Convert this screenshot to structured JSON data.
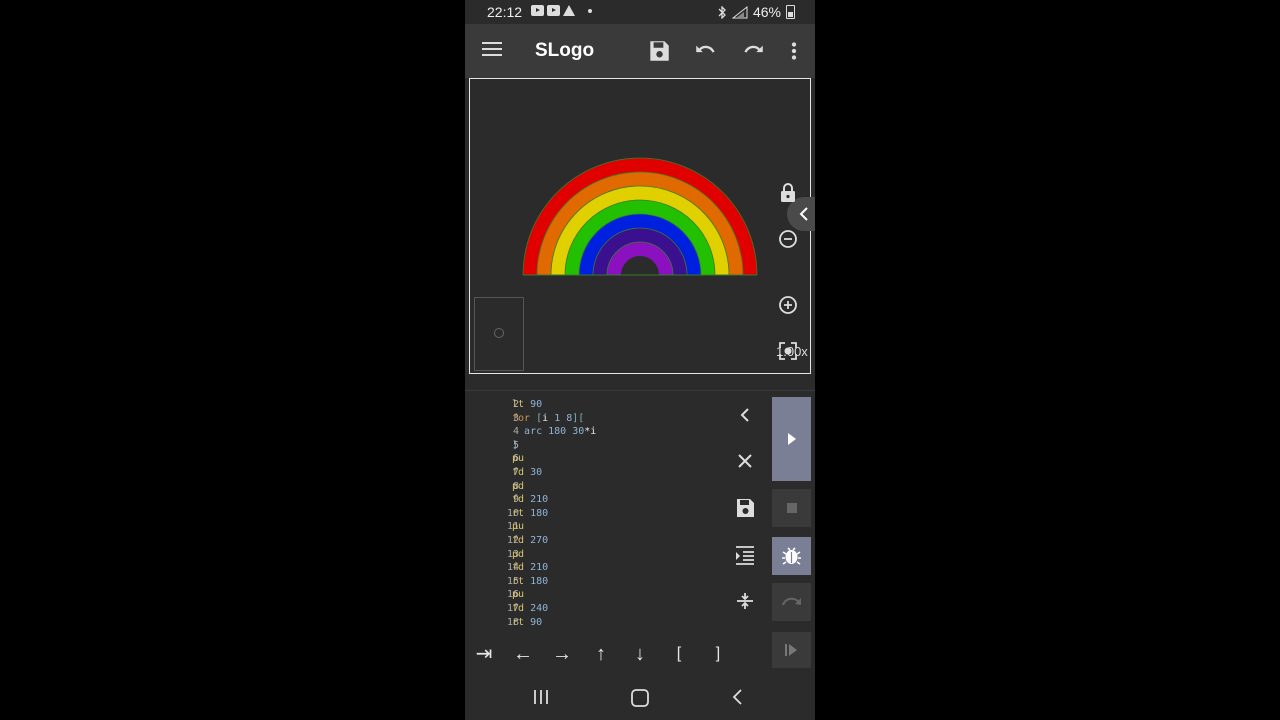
{
  "status_bar": {
    "time": "22:12",
    "battery": "46%",
    "icons": [
      "youtube-icon",
      "youtube-icon",
      "warning-icon",
      "bluetooth-icon",
      "signal-icon",
      "battery-icon"
    ]
  },
  "app_bar": {
    "title": "SLogo",
    "actions": [
      "save-icon",
      "undo-icon",
      "redo-icon",
      "more-vert-icon"
    ]
  },
  "canvas": {
    "zoom_level": "1.00x",
    "controls": [
      "collapse-icon",
      "lock-icon",
      "zoom-out-icon",
      "zoom-in-icon",
      "fit-screen-icon"
    ],
    "rainbow_colors": [
      "#e00000",
      "#e06a00",
      "#e0d000",
      "#22c000",
      "#0020e0",
      "#3a1090",
      "#8a10c0"
    ]
  },
  "editor": {
    "lines": [
      {
        "no": "2",
        "tokens": [
          [
            "kw",
            "lt"
          ],
          [
            "sp",
            " "
          ],
          [
            "num",
            "90"
          ]
        ]
      },
      {
        "no": "3",
        "tokens": [
          [
            "kw2",
            "for"
          ],
          [
            "sp",
            " "
          ],
          [
            "br",
            "["
          ],
          [
            "var",
            "i"
          ],
          [
            "sp",
            " "
          ],
          [
            "num",
            "1"
          ],
          [
            "sp",
            " "
          ],
          [
            "num",
            "8"
          ],
          [
            "br",
            "]["
          ]
        ]
      },
      {
        "no": "4",
        "tokens": [
          [
            "sp",
            "  "
          ],
          [
            "num",
            "arc"
          ],
          [
            "sp",
            " "
          ],
          [
            "num",
            "180"
          ],
          [
            "sp",
            " "
          ],
          [
            "num",
            "30"
          ],
          [
            "var",
            "*i"
          ]
        ]
      },
      {
        "no": "5",
        "tokens": [
          [
            "br",
            "]"
          ]
        ]
      },
      {
        "no": "6",
        "tokens": [
          [
            "kw",
            "pu"
          ]
        ]
      },
      {
        "no": "7",
        "tokens": [
          [
            "kw",
            "fd"
          ],
          [
            "sp",
            " "
          ],
          [
            "num",
            "30"
          ]
        ]
      },
      {
        "no": "8",
        "tokens": [
          [
            "kw",
            "pd"
          ]
        ]
      },
      {
        "no": "9",
        "tokens": [
          [
            "kw",
            "fd"
          ],
          [
            "sp",
            " "
          ],
          [
            "num",
            "210"
          ]
        ]
      },
      {
        "no": "10",
        "tokens": [
          [
            "kw",
            "rt"
          ],
          [
            "sp",
            " "
          ],
          [
            "num",
            "180"
          ]
        ]
      },
      {
        "no": "11",
        "tokens": [
          [
            "kw",
            "pu"
          ]
        ]
      },
      {
        "no": "12",
        "tokens": [
          [
            "kw",
            "fd"
          ],
          [
            "sp",
            " "
          ],
          [
            "num",
            "270"
          ]
        ]
      },
      {
        "no": "13",
        "tokens": [
          [
            "kw",
            "pd"
          ]
        ]
      },
      {
        "no": "14",
        "tokens": [
          [
            "kw",
            "fd"
          ],
          [
            "sp",
            " "
          ],
          [
            "num",
            "210"
          ]
        ]
      },
      {
        "no": "15",
        "tokens": [
          [
            "kw",
            "rt"
          ],
          [
            "sp",
            " "
          ],
          [
            "num",
            "180"
          ]
        ]
      },
      {
        "no": "16",
        "tokens": [
          [
            "kw",
            "pu"
          ]
        ]
      },
      {
        "no": "17",
        "tokens": [
          [
            "kw",
            "fd"
          ],
          [
            "sp",
            " "
          ],
          [
            "num",
            "240"
          ]
        ]
      },
      {
        "no": "18",
        "tokens": [
          [
            "kw",
            "rt"
          ],
          [
            "sp",
            " "
          ],
          [
            "num",
            "90"
          ]
        ]
      }
    ],
    "tools": [
      "chevron-left-icon",
      "close-icon",
      "save-icon",
      "format-indent-icon",
      "vertical-align-center-icon"
    ],
    "run_controls": [
      "play-icon",
      "stop-icon",
      "debug-icon",
      "step-over-icon",
      "step-icon"
    ]
  },
  "keys": [
    "⇥",
    "←",
    "→",
    "↑",
    "↓",
    "[",
    "]"
  ]
}
